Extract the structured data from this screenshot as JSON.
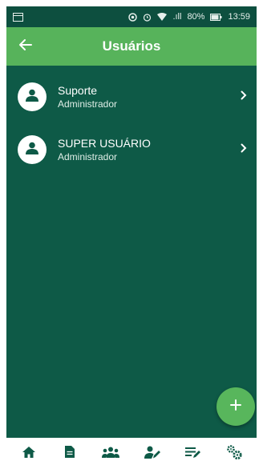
{
  "statusbar": {
    "signal_text": ".ıll",
    "battery_text": "80%",
    "time": "13:59"
  },
  "appbar": {
    "title": "Usuários",
    "back_icon": "arrow-left-icon"
  },
  "users": [
    {
      "name": "Suporte",
      "role": "Administrador"
    },
    {
      "name": "SUPER USUÁRIO",
      "role": "Administrador"
    }
  ],
  "fab": {
    "label": "+"
  },
  "bottom_nav": [
    {
      "icon": "home-icon"
    },
    {
      "icon": "document-icon"
    },
    {
      "icon": "users-group-icon"
    },
    {
      "icon": "user-edit-icon"
    },
    {
      "icon": "list-edit-icon"
    },
    {
      "icon": "settings-gears-icon"
    }
  ],
  "colors": {
    "background": "#0e5a47",
    "appbar": "#57b35b",
    "fab": "#58b65c",
    "nav_icons": "#0e5a47"
  }
}
